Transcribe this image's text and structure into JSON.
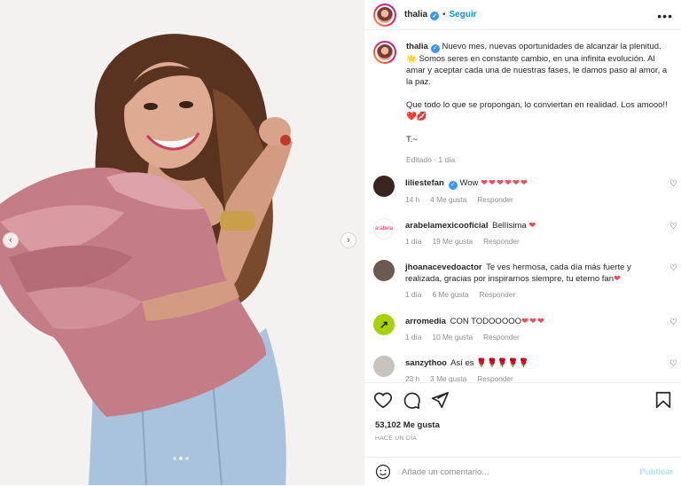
{
  "post": {
    "author": "thalia",
    "follow_label": "Seguir",
    "separator": "•",
    "more_label": "•••",
    "caption": {
      "line1": "Nuevo mes, nuevas oportunidades de alcanzar la plenitud. 🌟 Somos seres en constante cambio, en una infinita evolución. Al amar y aceptar cada una de nuestras fases, le damos paso al amor, a la paz.",
      "line2": "Que todo lo que se propongan, lo conviertan en realidad. Los amooo!! ❤️💋",
      "signature": "T.~",
      "meta": "Editado · 1 día"
    }
  },
  "comments": [
    {
      "user": "liliestefan",
      "verified": true,
      "text": "Wow",
      "hearts": "❤❤❤❤❤❤",
      "time": "14 h",
      "likes": "4 Me gusta",
      "reply": "Responder",
      "avatar_color": "#3a2420"
    },
    {
      "user": "arabelamexicooficial",
      "verified": false,
      "text": "Bellísima",
      "hearts": "❤",
      "time": "1 día",
      "likes": "19 Me gusta",
      "reply": "Responder",
      "avatar_color": "#ffffff"
    },
    {
      "user": "jhoanacevedoactor",
      "verified": false,
      "text": "Te ves hermosa, cada día más fuerte y realizada, gracias por inspirarnos siempre, tu eterno fan",
      "hearts": "❤",
      "time": "1 día",
      "likes": "6 Me gusta",
      "reply": "Responder",
      "avatar_color": "#6b5a50"
    },
    {
      "user": "arromedia",
      "verified": false,
      "text": "CON TODOOOOO",
      "hearts": "❤❤❤",
      "time": "1 día",
      "likes": "10 Me gusta",
      "reply": "Responder",
      "avatar_color": "#a6d20b"
    },
    {
      "user": "sanzythoo",
      "verified": false,
      "text": "Así es",
      "hearts": "🌹🌹🌹🌹🌹",
      "time": "23 h",
      "likes": "3 Me gusta",
      "reply": "Responder",
      "avatar_color": "#c9c3bd"
    }
  ],
  "arabela_logo": "arabela",
  "likes_count": "53,102 Me gusta",
  "posted_ago": "HACE UN DÍA",
  "comment_input": {
    "placeholder": "Añade un comentario...",
    "value": ""
  },
  "publish_label": "Publicar",
  "colors": {
    "accent": "#0095f6",
    "heart": "#ed4956",
    "muted": "#8e8e8e"
  },
  "icons": {
    "like": "heart-icon",
    "comment": "comment-icon",
    "share": "share-icon",
    "save": "bookmark-icon",
    "emoji": "emoji-icon",
    "verified": "verified-badge-icon"
  }
}
